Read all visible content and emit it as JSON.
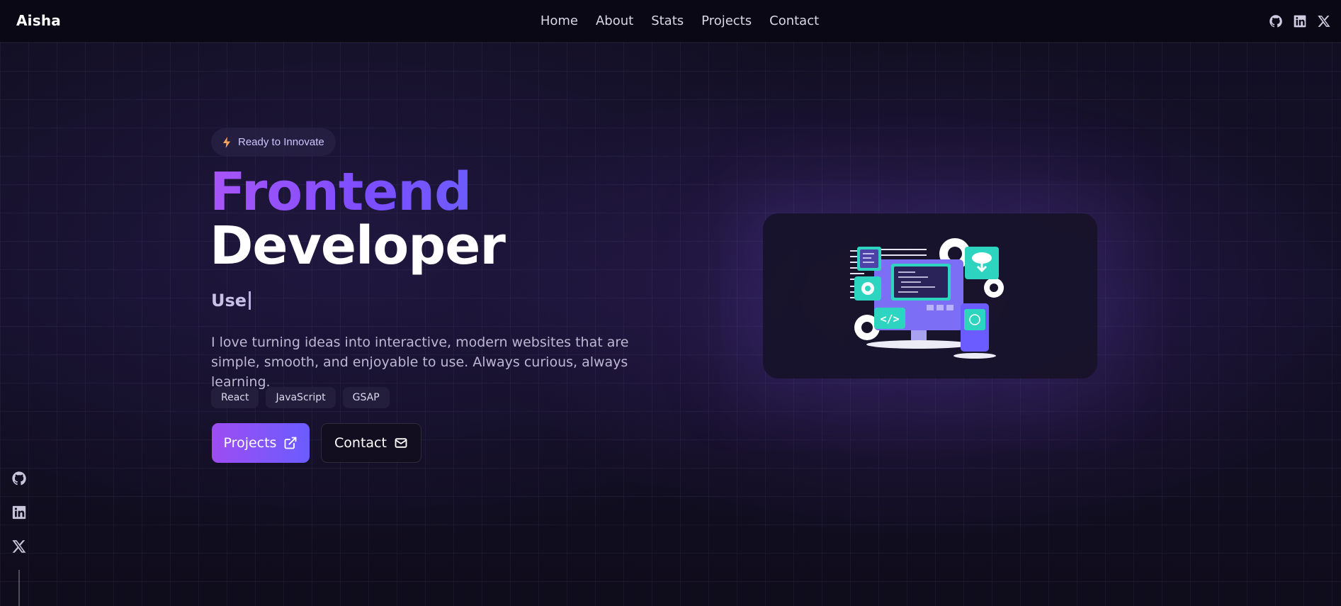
{
  "nav": {
    "brand": "Aisha",
    "links": [
      "Home",
      "About",
      "Stats",
      "Projects",
      "Contact"
    ]
  },
  "social": {
    "icons": [
      "github-icon",
      "linkedin-icon",
      "x-icon"
    ]
  },
  "hero": {
    "badge": "Ready to Innovate",
    "title_line1": "Frontend",
    "title_line2": "Developer",
    "typed_text": "Use",
    "description": "I love turning ideas into interactive, modern websites that are simple, smooth, and enjoyable to use. Always curious, always learning.",
    "tags": [
      "React",
      "JavaScript",
      "GSAP"
    ],
    "primary_button": "Projects",
    "secondary_button": "Contact"
  },
  "colors": {
    "accent_start": "#a855f7",
    "accent_end": "#6b5cff",
    "background": "#120f22",
    "illustration_teal": "#2dd4bf"
  }
}
